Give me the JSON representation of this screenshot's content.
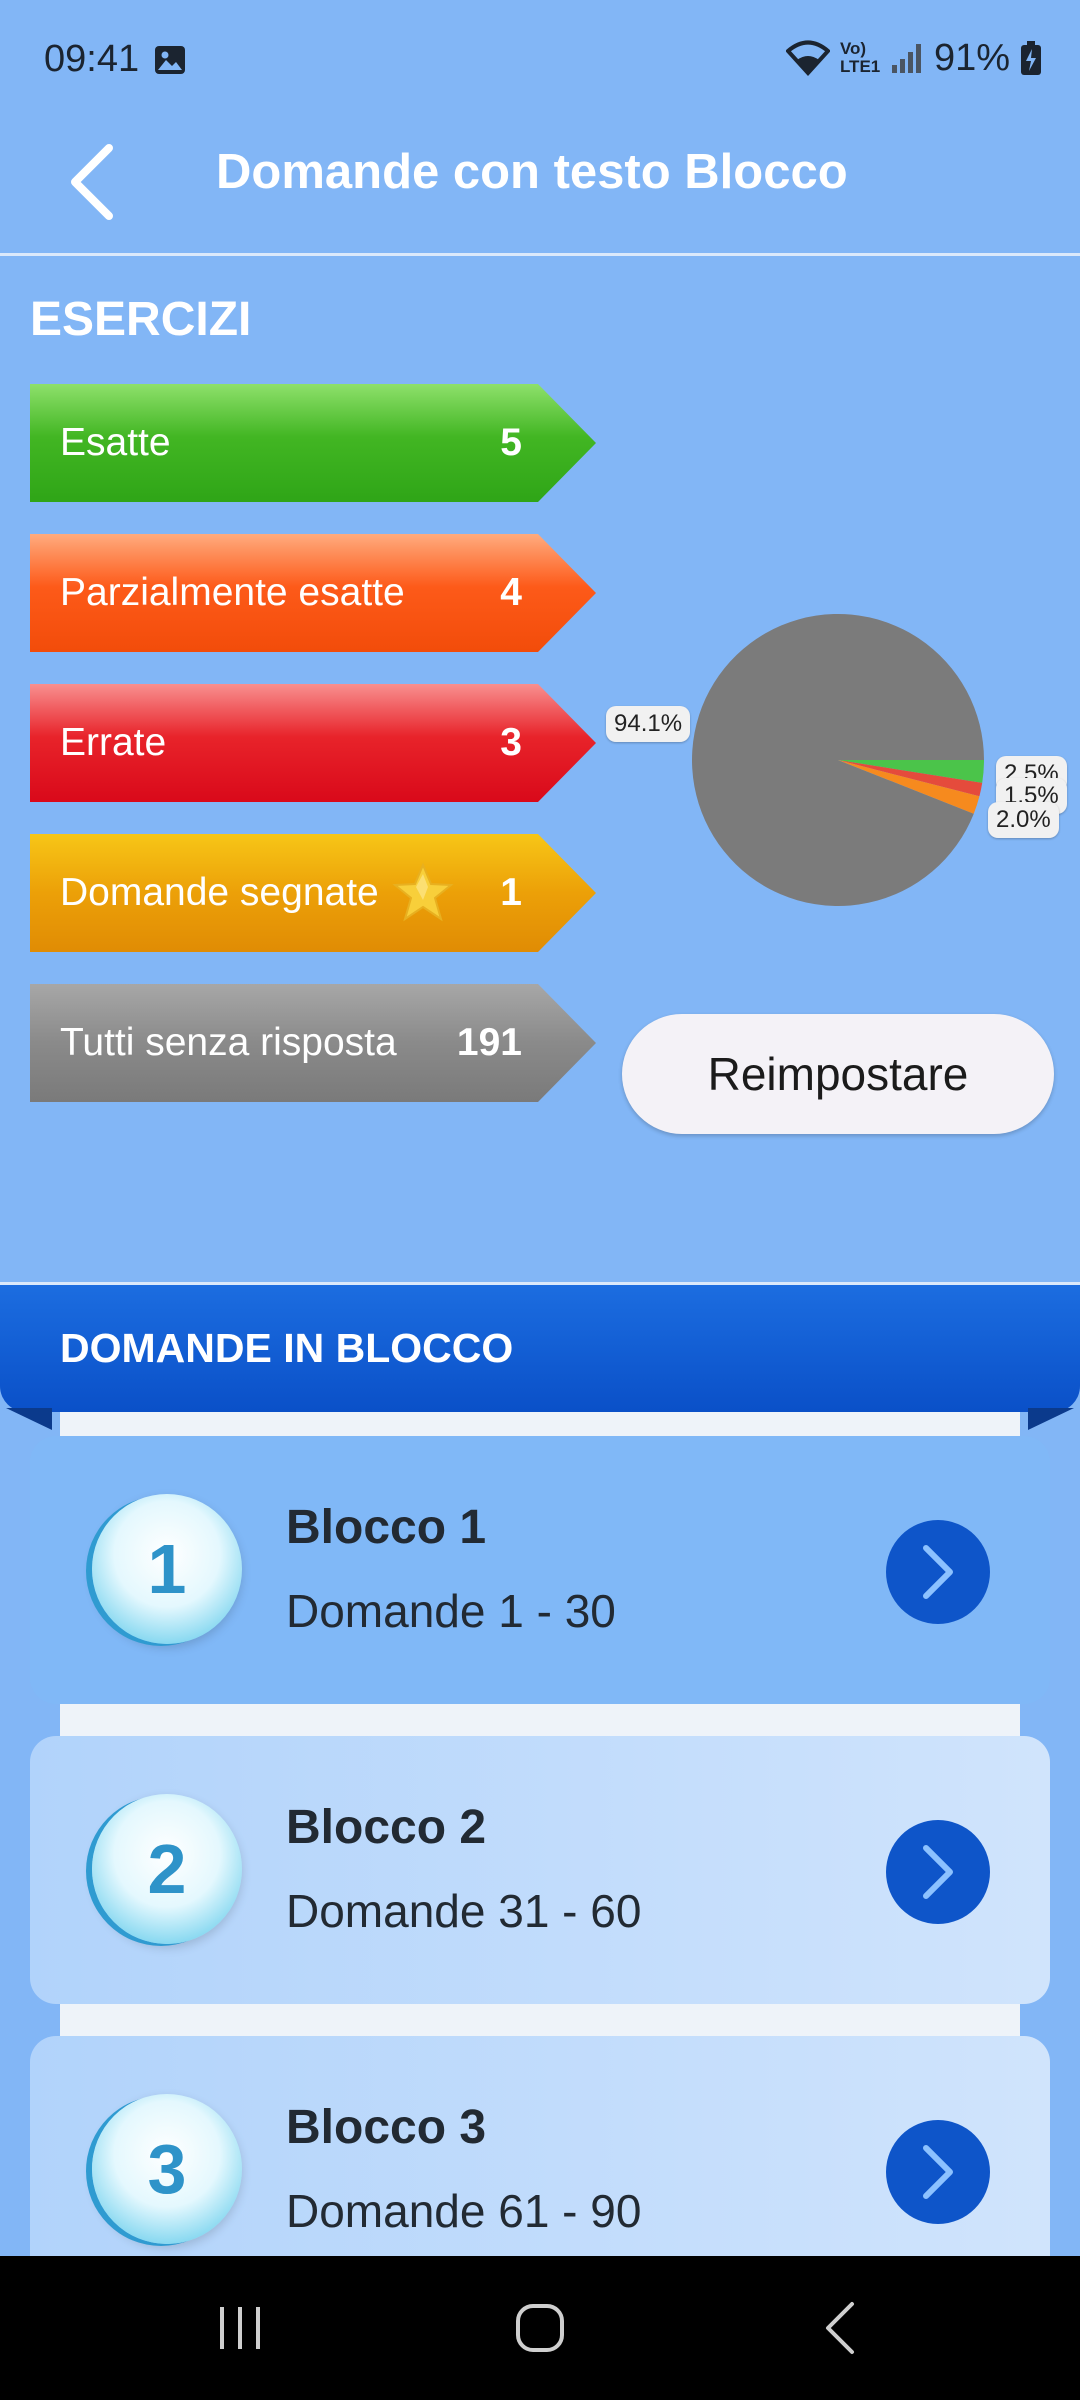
{
  "status_bar": {
    "time": "09:41",
    "network": "Vo) LTE1",
    "battery": "91%"
  },
  "app_bar": {
    "title": "Domande con testo Blocco",
    "back_icon": "chevron-left-icon"
  },
  "exercises": {
    "title": "ESERCIZI",
    "bars": [
      {
        "label": "Esatte",
        "count": "5",
        "color": "#3fb320"
      },
      {
        "label": "Parzialmente esatte",
        "count": "4",
        "color": "#fb5514"
      },
      {
        "label": "Errate",
        "count": "3",
        "color": "#e31c24"
      },
      {
        "label": "Domande segnate",
        "count": "1",
        "color": "#e9990a",
        "icon": "star-icon"
      },
      {
        "label": "Tutti senza risposta",
        "count": "191",
        "color": "#858585"
      }
    ],
    "reset_label": "Reimpostare"
  },
  "chart_data": {
    "type": "pie",
    "slices": [
      {
        "label": "94.1%",
        "value": 94.1,
        "color": "#7b7b7b"
      },
      {
        "label": "2.5%",
        "value": 2.5,
        "color": "#4bc44a"
      },
      {
        "label": "1.5%",
        "value": 1.5,
        "color": "#e54b3c"
      },
      {
        "label": "2.0%",
        "value": 2.0,
        "color": "#f68a1e"
      }
    ]
  },
  "blocks": {
    "header": "DOMANDE IN BLOCCO",
    "items": [
      {
        "number": "1",
        "title": "Blocco 1",
        "range": "Domande 1 - 30"
      },
      {
        "number": "2",
        "title": "Blocco 2",
        "range": "Domande 31 - 60"
      },
      {
        "number": "3",
        "title": "Blocco 3",
        "range": "Domande 61 - 90"
      }
    ]
  },
  "nav_bar": {
    "recents_icon": "recents-icon",
    "home_icon": "home-icon",
    "back_icon": "back-icon"
  }
}
